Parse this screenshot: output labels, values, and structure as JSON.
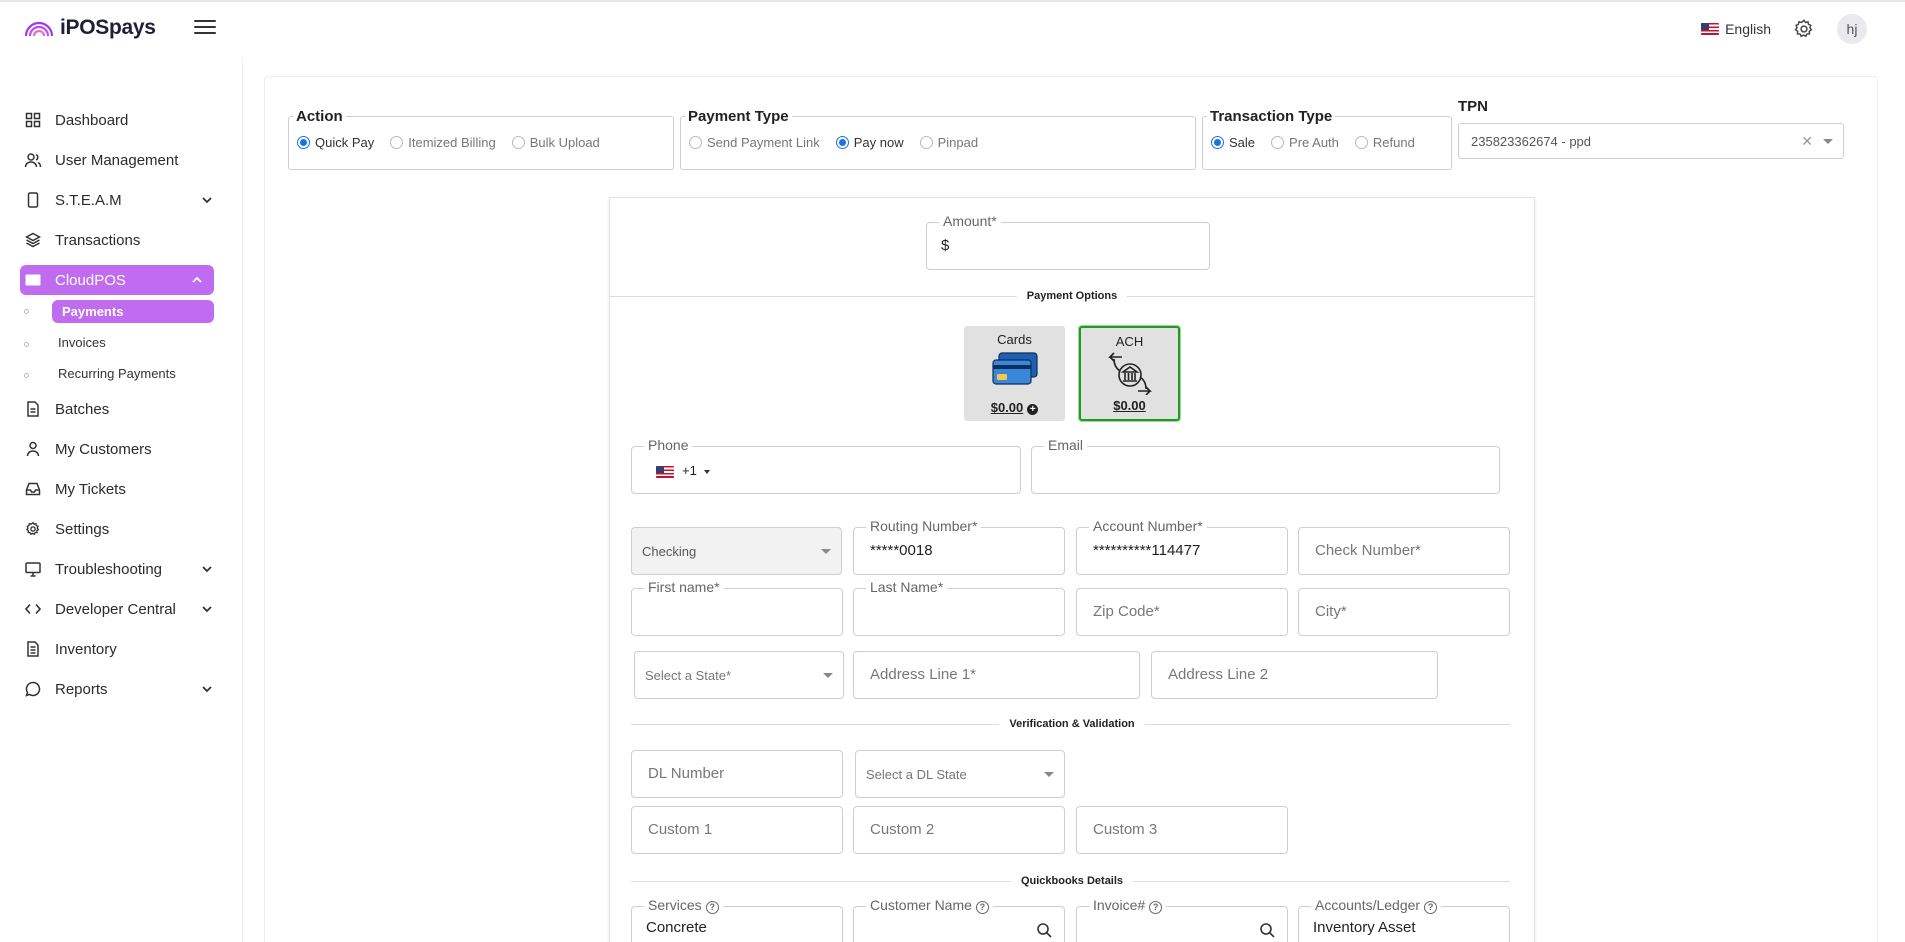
{
  "brand": {
    "name": "iPOSpays"
  },
  "header": {
    "language": "English",
    "avatar_initials": "hj"
  },
  "sidebar": {
    "items": [
      {
        "label": "Dashboard",
        "icon": "dashboard-icon"
      },
      {
        "label": "User Management",
        "icon": "user-icon"
      },
      {
        "label": "S.T.E.A.M",
        "icon": "device-icon"
      },
      {
        "label": "Transactions",
        "icon": "layers-icon"
      },
      {
        "label": "CloudPOS",
        "icon": "card-icon"
      },
      {
        "label": "Batches",
        "icon": "file-icon"
      },
      {
        "label": "My Customers",
        "icon": "person-icon"
      },
      {
        "label": "My Tickets",
        "icon": "inbox-icon"
      },
      {
        "label": "Settings",
        "icon": "gear-icon"
      },
      {
        "label": "Troubleshooting",
        "icon": "monitor-icon"
      },
      {
        "label": "Developer Central",
        "icon": "code-icon"
      },
      {
        "label": "Inventory",
        "icon": "list-icon"
      },
      {
        "label": "Reports",
        "icon": "chat-icon"
      }
    ],
    "cloudpos_sub": [
      {
        "label": "Payments"
      },
      {
        "label": "Invoices"
      },
      {
        "label": "Recurring Payments"
      }
    ]
  },
  "action": {
    "title": "Action",
    "options": [
      "Quick Pay",
      "Itemized Billing",
      "Bulk Upload"
    ],
    "selected": "Quick Pay"
  },
  "payment_type": {
    "title": "Payment Type",
    "options": [
      "Send Payment Link",
      "Pay now",
      "Pinpad"
    ],
    "selected": "Pay now"
  },
  "transaction_type": {
    "title": "Transaction Type",
    "options": [
      "Sale",
      "Pre Auth",
      "Refund"
    ],
    "selected": "Sale"
  },
  "tpn": {
    "label": "TPN",
    "value": "235823362674 - ppd"
  },
  "form": {
    "amount_label": "Amount*",
    "amount_prefix": "$",
    "payment_options_title": "Payment Options",
    "tiles": [
      {
        "name": "Cards",
        "amount": "$0.00"
      },
      {
        "name": "ACH",
        "amount": "$0.00"
      }
    ],
    "phone_label": "Phone",
    "phone_code": "+1",
    "email_label": "Email",
    "account_type": "Checking",
    "routing_label": "Routing Number*",
    "routing_value": "*****0018",
    "account_label": "Account Number*",
    "account_value": "**********114477",
    "check_number": "Check Number*",
    "first_name_label": "First name*",
    "last_name_label": "Last Name*",
    "zip": "Zip Code*",
    "city": "City*",
    "state_ph": "Select a State*",
    "address1": "Address Line 1*",
    "address2": "Address Line 2",
    "verification_title": "Verification & Validation",
    "dl_number": "DL Number",
    "dl_state_ph": "Select a DL State",
    "custom1": "Custom 1",
    "custom2": "Custom 2",
    "custom3": "Custom 3",
    "quickbooks_title": "Quickbooks Details",
    "services_label": "Services",
    "services_value": "Concrete",
    "customer_name_label": "Customer Name",
    "invoice_label": "Invoice#",
    "accounts_label": "Accounts/Ledger",
    "accounts_value": "Inventory Asset"
  }
}
